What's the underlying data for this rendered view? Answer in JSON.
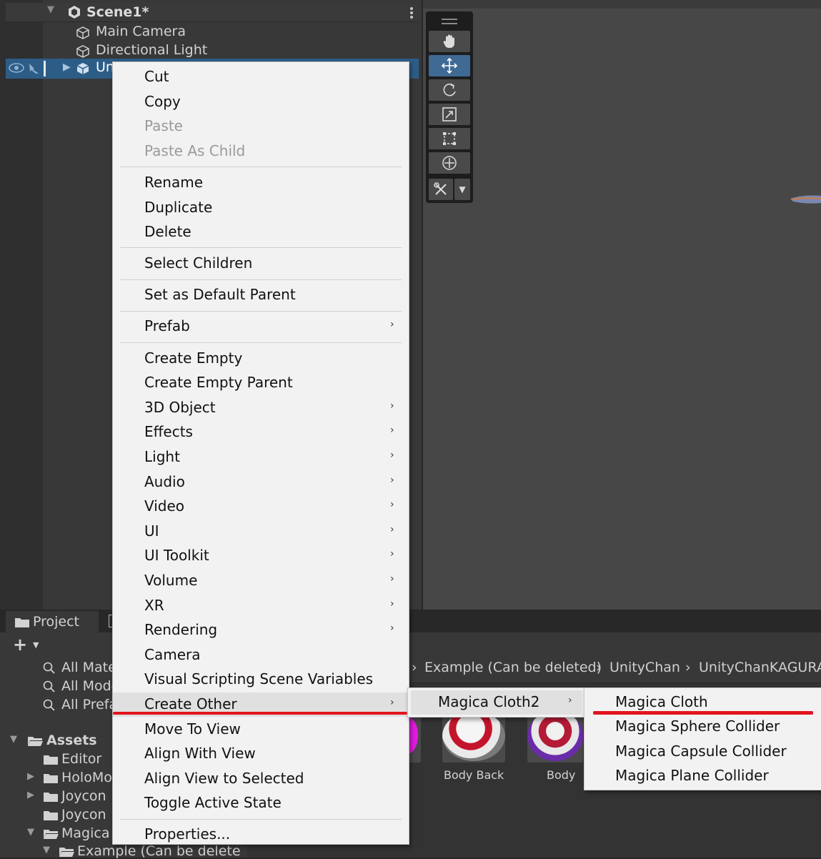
{
  "hierarchy": {
    "scene_name": "Scene1*",
    "items": [
      {
        "label": "Main Camera"
      },
      {
        "label": "Directional Light"
      }
    ],
    "selected_item_label": "Un"
  },
  "scene_tools": {
    "items": [
      "hand-tool",
      "move-tool",
      "rotate-tool",
      "scale-tool",
      "rect-tool",
      "transform-tool",
      "custom-editor-tool"
    ],
    "active": "move-tool"
  },
  "project": {
    "tab_label": "Project",
    "favorites": [
      "All Mate",
      "All Mode",
      "All Prefa"
    ],
    "assets_label": "Assets",
    "tree": [
      "Editor",
      "HoloMo",
      "Joycon",
      "Joycon",
      "Magica",
      "Example (Can be delete"
    ],
    "breadcrumb": [
      "Example (Can be deleted)",
      "UnityChan",
      "UnityChanKAGURA"
    ],
    "thumbnails": [
      {
        "label": "Body Back"
      },
      {
        "label": "Body"
      }
    ]
  },
  "context_menu": {
    "groups": [
      [
        {
          "label": "Cut",
          "enabled": true
        },
        {
          "label": "Copy",
          "enabled": true
        },
        {
          "label": "Paste",
          "enabled": false
        },
        {
          "label": "Paste As Child",
          "enabled": false
        }
      ],
      [
        {
          "label": "Rename"
        },
        {
          "label": "Duplicate"
        },
        {
          "label": "Delete"
        }
      ],
      [
        {
          "label": "Select Children"
        }
      ],
      [
        {
          "label": "Set as Default Parent"
        }
      ],
      [
        {
          "label": "Prefab",
          "submenu": true
        }
      ],
      [
        {
          "label": "Create Empty"
        },
        {
          "label": "Create Empty Parent"
        },
        {
          "label": "3D Object",
          "submenu": true
        },
        {
          "label": "Effects",
          "submenu": true
        },
        {
          "label": "Light",
          "submenu": true
        },
        {
          "label": "Audio",
          "submenu": true
        },
        {
          "label": "Video",
          "submenu": true
        },
        {
          "label": "UI",
          "submenu": true
        },
        {
          "label": "UI Toolkit",
          "submenu": true
        },
        {
          "label": "Volume",
          "submenu": true
        },
        {
          "label": "XR",
          "submenu": true
        },
        {
          "label": "Rendering",
          "submenu": true
        },
        {
          "label": "Camera"
        },
        {
          "label": "Visual Scripting Scene Variables"
        },
        {
          "label": "Create Other",
          "submenu": true,
          "highlighted": true
        },
        {
          "label": "Move To View"
        },
        {
          "label": "Align With View"
        },
        {
          "label": "Align View to Selected"
        },
        {
          "label": "Toggle Active State"
        }
      ],
      [
        {
          "label": "Properties..."
        }
      ]
    ],
    "submenu_create_other": {
      "label": "Magica Cloth2"
    },
    "submenu_magica_cloth2": [
      "Magica Cloth",
      "Magica Sphere Collider",
      "Magica Capsule Collider",
      "Magica Plane Collider"
    ],
    "arrow_glyph": "›"
  },
  "colors": {
    "annotation_red": "#e3141c",
    "selection_blue": "#2c5d87",
    "active_tool_blue": "#3f6a94"
  }
}
